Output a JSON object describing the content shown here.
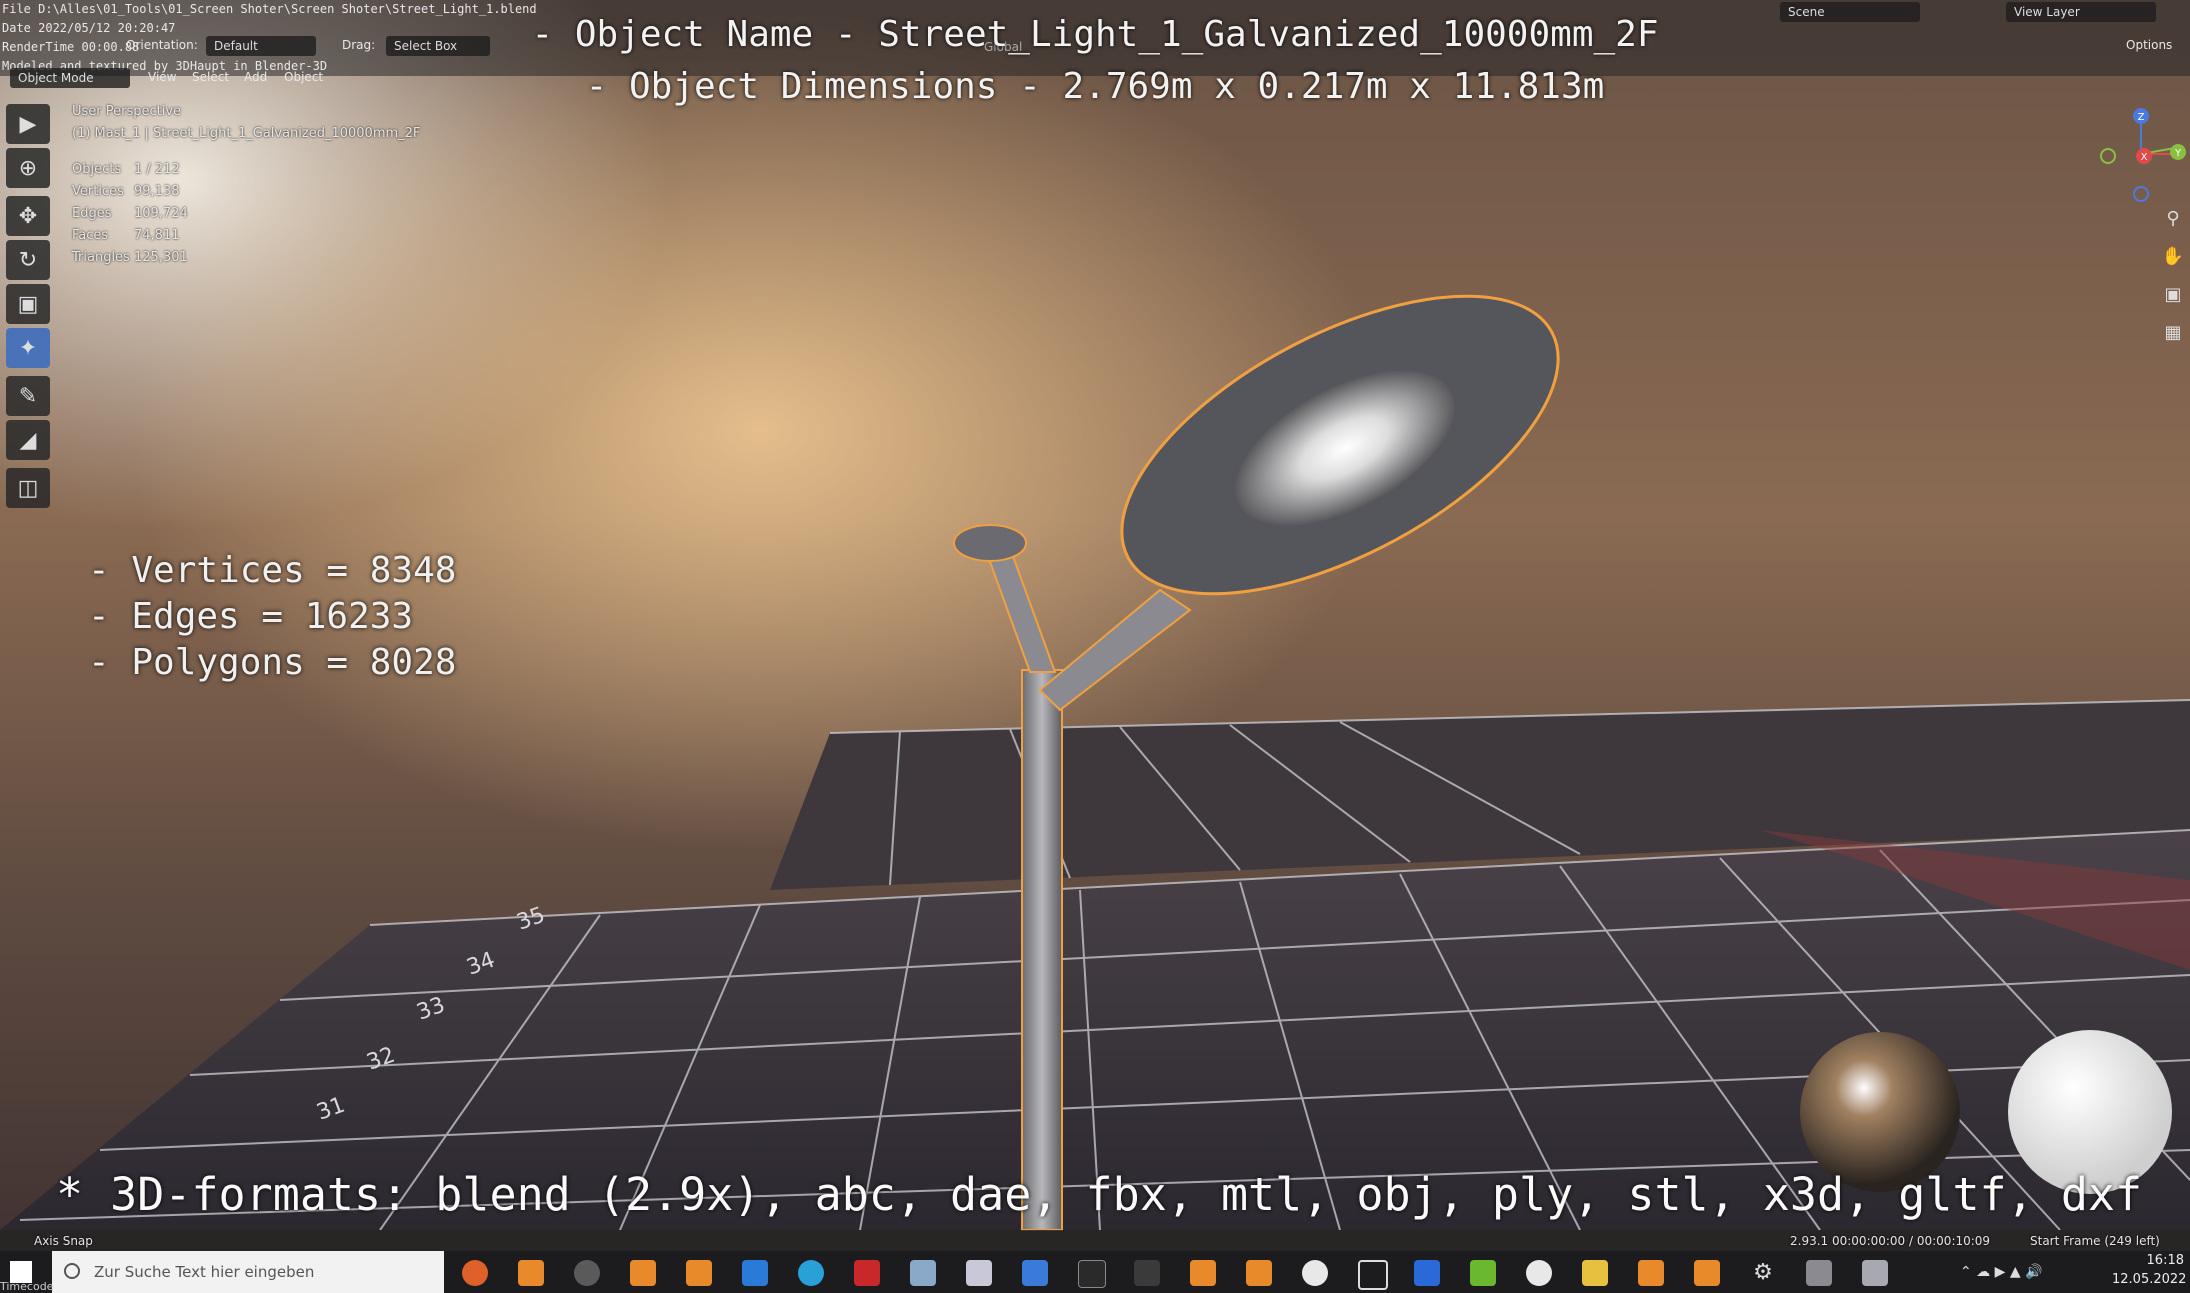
{
  "header": {
    "file_path": "File D:\\Alles\\01_Tools\\01_Screen Shoter\\Screen Shoter\\Street_Light_1.blend",
    "date": "Date 2022/05/12 20:20:47",
    "render_time": "RenderTime 00:00.88",
    "credit": "Modeled and textured by 3DHaupt in Blender-3D",
    "orientation_label": "Orientation:",
    "orientation_value": "Default",
    "drag_label": "Drag:",
    "drag_value": "Select Box",
    "mode": "Object Mode",
    "menu": [
      "View",
      "Select",
      "Add",
      "Object"
    ],
    "transform_orientation": "Global",
    "scene_label": "Scene",
    "view_layer_label": "View Layer",
    "options_label": "Options"
  },
  "overlay": {
    "object_name": "- Object Name - Street_Light_1_Galvanized_10000mm_2F",
    "object_dimensions": "- Object Dimensions -  2.769m x 0.217m x 11.813m",
    "stats": [
      "- Vertices = 8348",
      "- Edges = 16233",
      "- Polygons = 8028"
    ],
    "formats": "* 3D-formats: blend (2.9x), abc, dae, fbx, mtl, obj, ply, stl, x3d, gltf, dxf"
  },
  "viewport_info": {
    "perspective": "User Perspective",
    "selection": "(1) Mast_1 | Street_Light_1_Galvanized_10000mm_2F",
    "rows": [
      {
        "label": "Objects",
        "value": "1 / 212"
      },
      {
        "label": "Vertices",
        "value": "99,138"
      },
      {
        "label": "Edges",
        "value": "109,724"
      },
      {
        "label": "Faces",
        "value": "74,811"
      },
      {
        "label": "Triangles",
        "value": "125,301"
      }
    ]
  },
  "gizmo": {
    "axes": [
      "Z",
      "X",
      "Y"
    ]
  },
  "status": {
    "left": "Axis Snap",
    "version": "2.93.1   00:00:00:00 / 00:00:10:09",
    "frame": "Start Frame (249 left)"
  },
  "taskbar": {
    "search_placeholder": "Zur Suche Text hier eingeben",
    "time": "16:18",
    "date": "12.05.2022",
    "timecode": "Timecode"
  },
  "colors": {
    "accent": "#4a72b8",
    "selection_outline": "#f0a040"
  }
}
